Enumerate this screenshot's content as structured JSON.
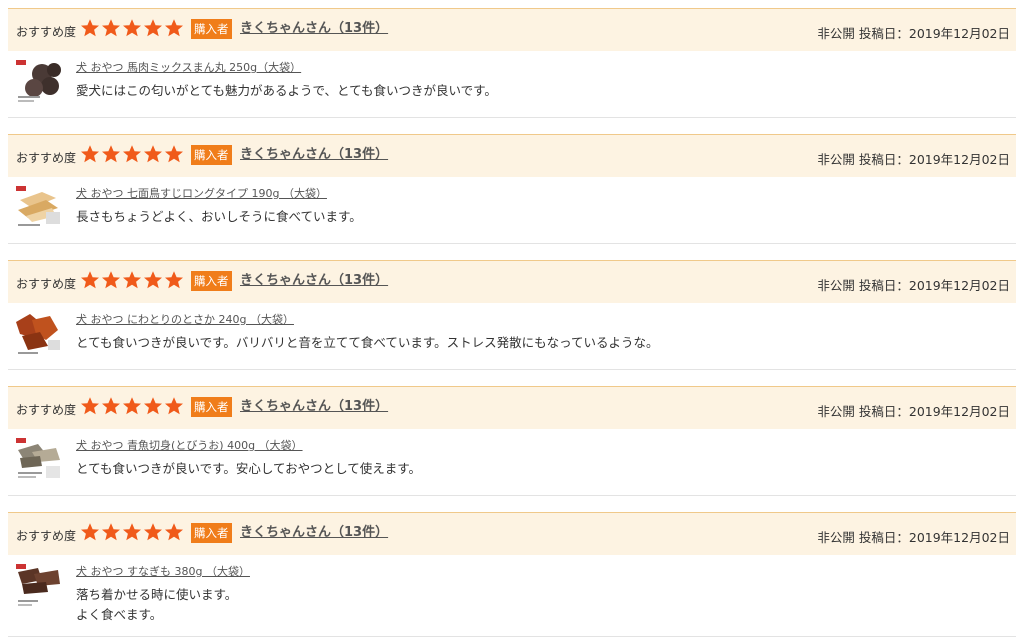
{
  "labels": {
    "recommend": "おすすめ度",
    "buyer_badge": "購入者",
    "visibility": "非公開",
    "posted_prefix": "投稿日：",
    "rating": 5,
    "star_color": "#f05a1a",
    "header_bg": "#fdf3e2",
    "badge_color": "#f07d1a"
  },
  "reviews": [
    {
      "reviewer": "きくちゃんさん（13件）",
      "date": "2019年12月02日",
      "product": "犬 おやつ 馬肉ミックスまん丸 250g（大袋）",
      "comment": [
        "愛犬にはこの匂いがとても魅力があるようで、とても食いつきが良いです。"
      ],
      "thumb_icon": "dark-round-treats-icon"
    },
    {
      "reviewer": "きくちゃんさん（13件）",
      "date": "2019年12月02日",
      "product": "犬 おやつ 七面鳥すじロングタイプ 190g （大袋）",
      "comment": [
        "長さもちょうどよく、おいしそうに食べています。"
      ],
      "thumb_icon": "turkey-tendon-sticks-icon"
    },
    {
      "reviewer": "きくちゃんさん（13件）",
      "date": "2019年12月02日",
      "product": "犬 おやつ にわとりのとさか 240g （大袋）",
      "comment": [
        "とても食いつきが良いです。バリバリと音を立てて食べています。ストレス発散にもなっているような。"
      ],
      "thumb_icon": "chicken-comb-treats-icon"
    },
    {
      "reviewer": "きくちゃんさん（13件）",
      "date": "2019年12月02日",
      "product": "犬 おやつ 青魚切身(とびうお) 400g （大袋）",
      "comment": [
        "とても食いつきが良いです。安心しておやつとして使えます。"
      ],
      "thumb_icon": "flying-fish-fillet-icon"
    },
    {
      "reviewer": "きくちゃんさん（13件）",
      "date": "2019年12月02日",
      "product": "犬 おやつ すなぎも 380g （大袋）",
      "comment": [
        "落ち着かせる時に使います。",
        "よく食べます。"
      ],
      "thumb_icon": "gizzard-treats-icon"
    }
  ]
}
